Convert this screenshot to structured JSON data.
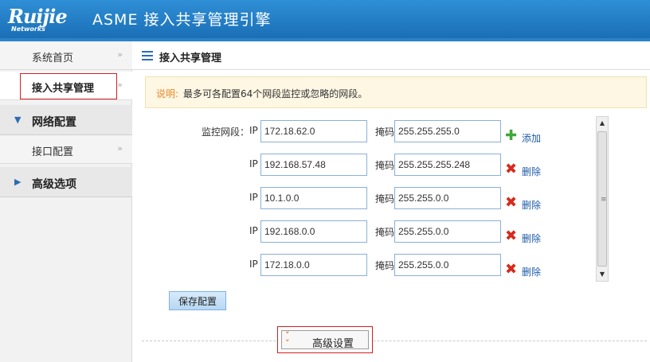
{
  "header": {
    "logo_text": "Ruijie",
    "logo_sub": "Networks",
    "app_title": "ASME 接入共享管理引擎"
  },
  "sidebar": {
    "items": [
      {
        "label": "系统首页",
        "chevron": "»"
      },
      {
        "label": "接入共享管理",
        "chevron": "»"
      },
      {
        "label": "网络配置",
        "icon": "triangle-down-icon"
      },
      {
        "label": "接口配置",
        "chevron": "»"
      },
      {
        "label": "高级选项",
        "icon": "triangle-right-icon"
      }
    ]
  },
  "main": {
    "page_title": "接入共享管理",
    "notice_key": "说明:",
    "notice_text": "最多可各配置64个网段监控或忽略的网段。",
    "monitor_label": "监控网段：",
    "ip_label": "IP",
    "mask_label": "掩码",
    "add_label": "添加",
    "delete_label": "删除",
    "rows": [
      {
        "ip": "172.18.62.0",
        "mask": "255.255.255.0",
        "action": "add"
      },
      {
        "ip": "192.168.57.48",
        "mask": "255.255.255.248",
        "action": "delete"
      },
      {
        "ip": "10.1.0.0",
        "mask": "255.255.0.0",
        "action": "delete"
      },
      {
        "ip": "192.168.0.0",
        "mask": "255.255.0.0",
        "action": "delete"
      },
      {
        "ip": "172.18.0.0",
        "mask": "255.255.0.0",
        "action": "delete"
      }
    ],
    "save_label": "保存配置",
    "advanced_label": "高级设置"
  },
  "colors": {
    "header": "#1f78c1",
    "highlight_border": "#d02020",
    "notice_key": "#e8892b",
    "add_icon": "#3fa83a",
    "delete_icon": "#d62a1e"
  }
}
